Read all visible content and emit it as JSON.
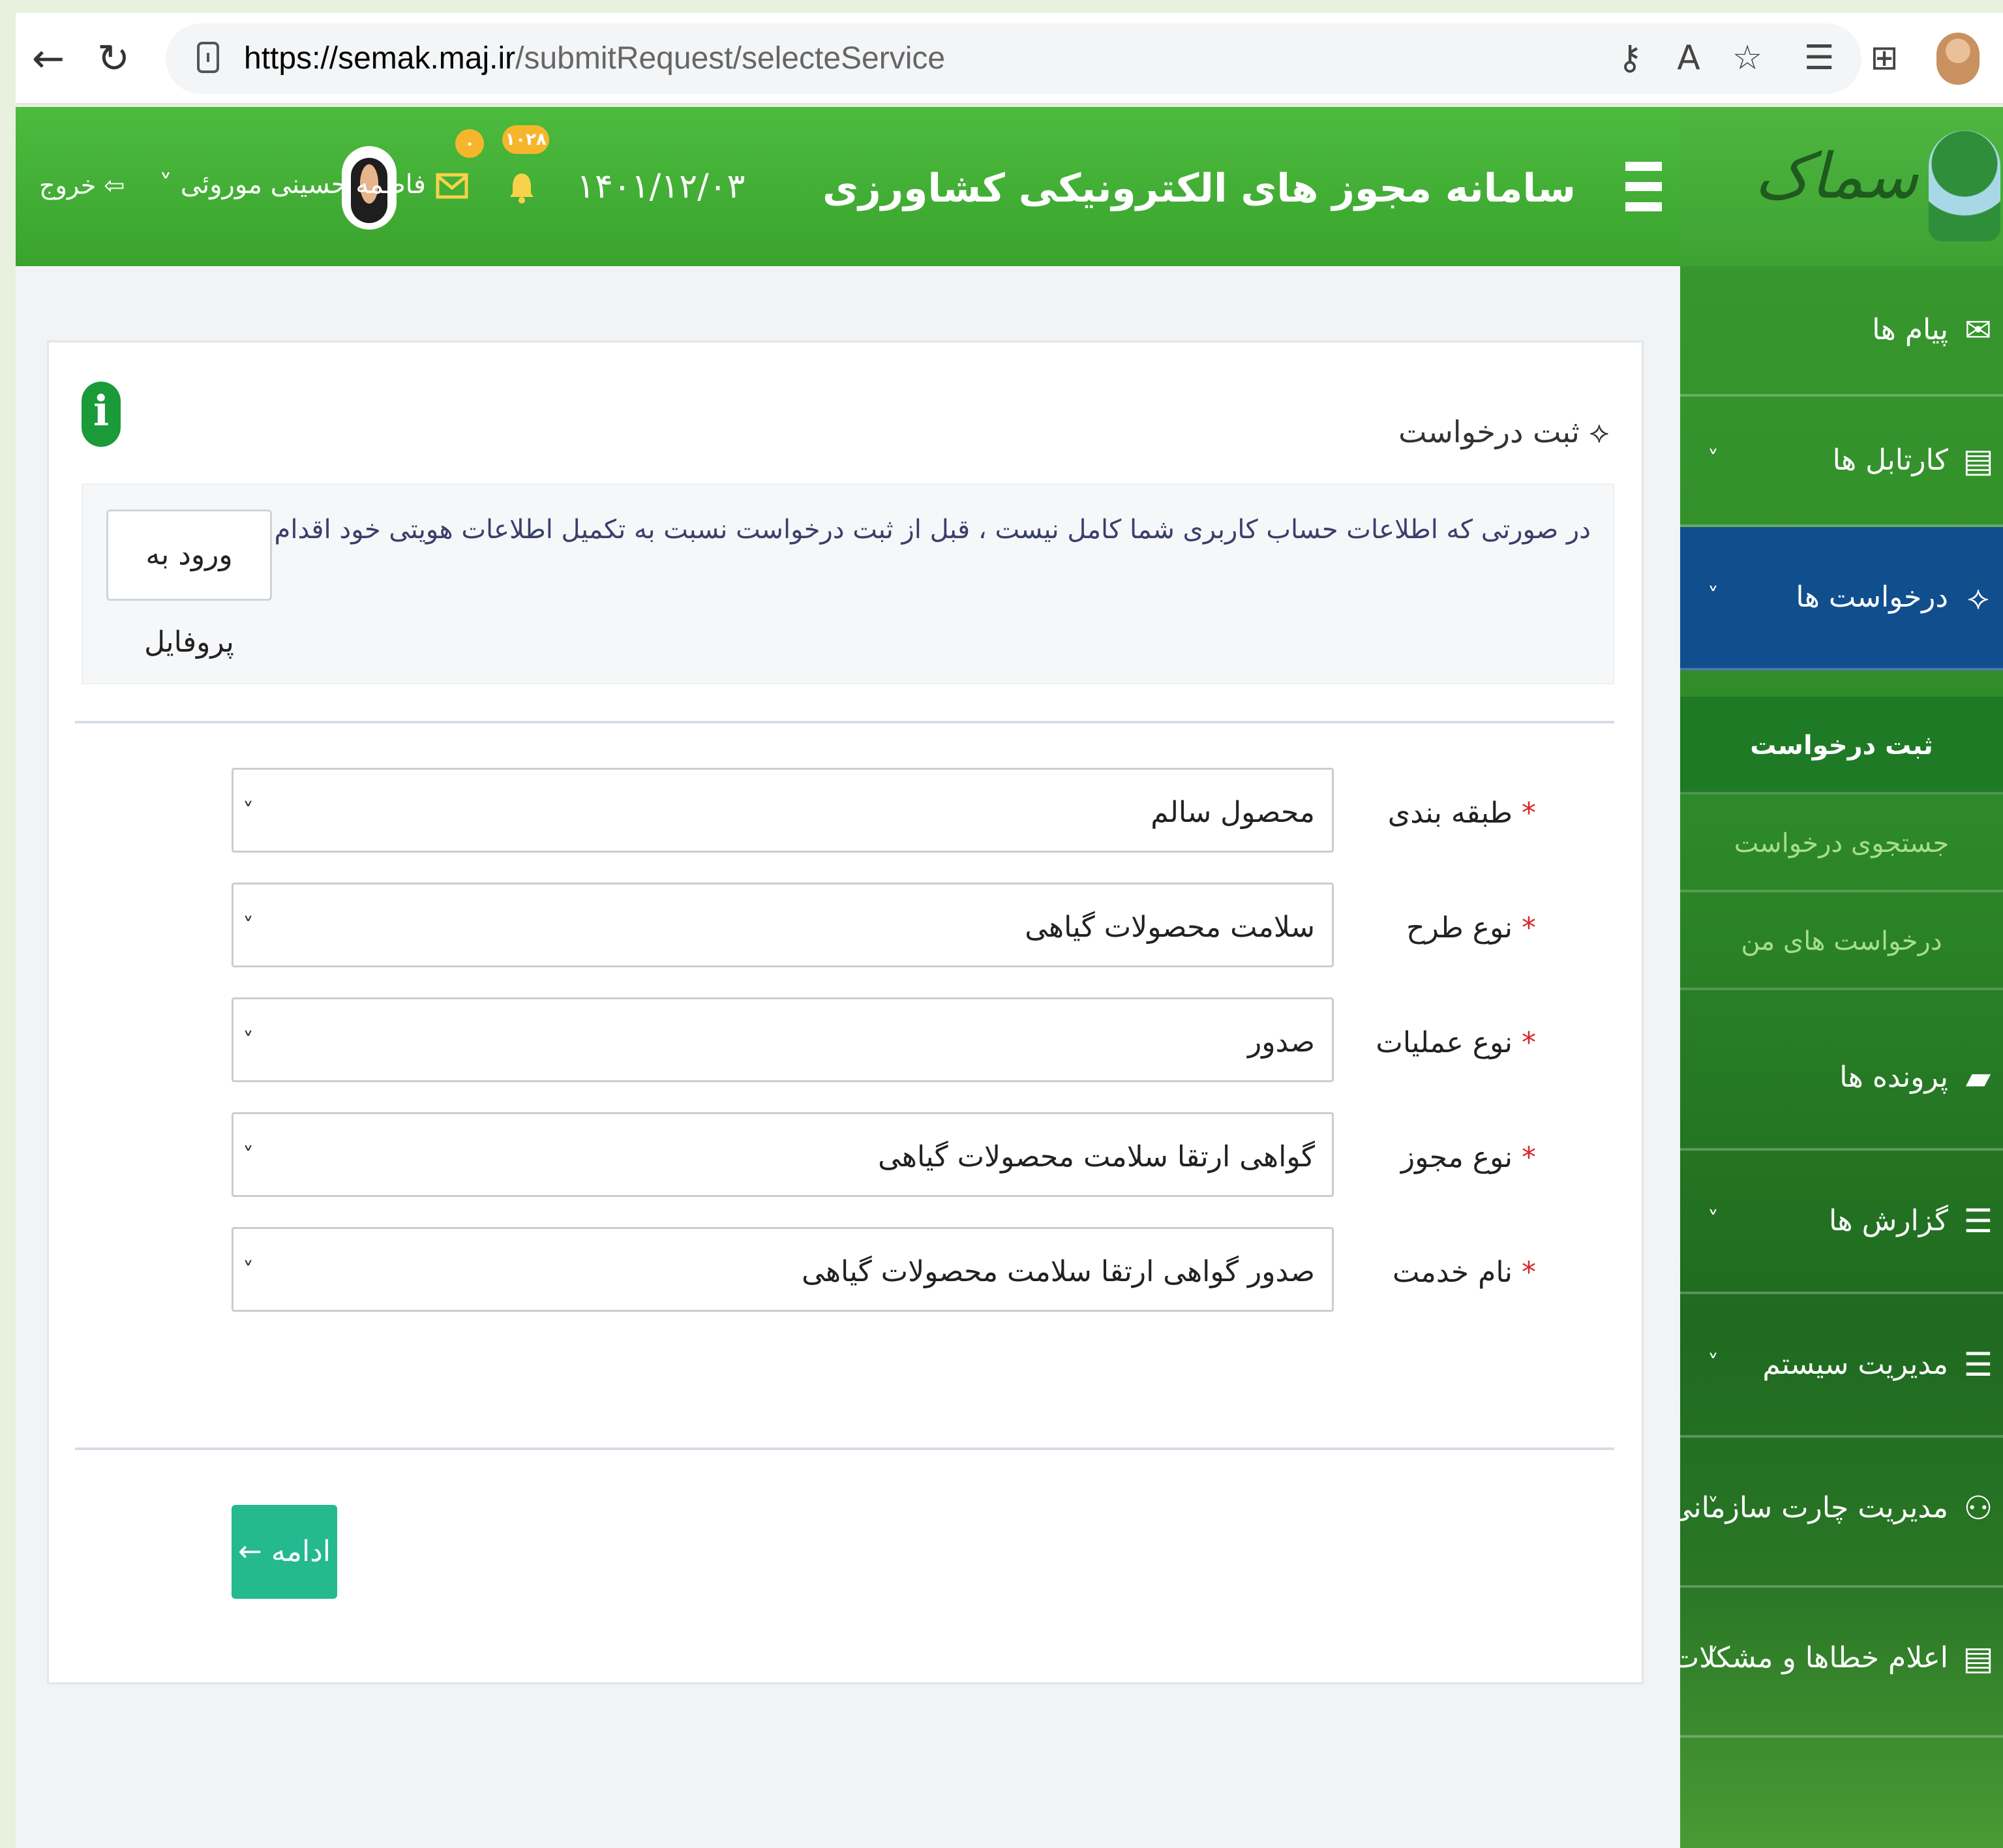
{
  "browser": {
    "url_host": "https://semak.maj.ir",
    "url_path": "/submitRequest/selecteService"
  },
  "header": {
    "title": "سامانه مجوز های الکترونیکی کشاورزی",
    "date": "۱۴۰۱/۱۲/۰۳",
    "notification_count": "۱۰۲۸",
    "message_count": "۰",
    "user_name": "فاطمه حسینی موروئی",
    "logout_label": "خروج"
  },
  "sidebar": {
    "logo_text": "سماک",
    "items": [
      {
        "label": "پیام ها",
        "icon": "envelope-icon",
        "has_chevron": false
      },
      {
        "label": "کارتابل ها",
        "icon": "document-icon",
        "has_chevron": true
      },
      {
        "label": "درخواست ها",
        "icon": "handshake-icon",
        "has_chevron": true,
        "active": true
      },
      {
        "label": "پرونده ها",
        "icon": "folder-icon",
        "has_chevron": false
      },
      {
        "label": "گزارش ها",
        "icon": "list-icon",
        "has_chevron": true
      },
      {
        "label": "مدیریت سیستم",
        "icon": "list-icon",
        "has_chevron": true
      },
      {
        "label": "مدیریت چارت سازمانی",
        "icon": "sitemap-icon",
        "has_chevron": true
      },
      {
        "label": "اعلام خطاها و مشکلات",
        "icon": "document-icon",
        "has_chevron": true
      }
    ],
    "sub_items": [
      {
        "label": "ثبت درخواست",
        "current": true
      },
      {
        "label": "جستجوی درخواست",
        "current": false
      },
      {
        "label": "درخواست های من",
        "current": false
      }
    ]
  },
  "main": {
    "title": "ثبت درخواست",
    "alert_text": "در صورتی که اطلاعات حساب کاربری شما کامل نیست ، قبل از ثبت درخواست نسبت به تکمیل اطلاعات هویتی خود اقدام فرمایید.",
    "profile_button": "ورود به پروفایل",
    "fields": [
      {
        "label": "طبقه بندی",
        "value": "محصول سالم"
      },
      {
        "label": "نوع طرح",
        "value": "سلامت محصولات گیاهی"
      },
      {
        "label": "نوع عملیات",
        "value": "صدور"
      },
      {
        "label": "نوع مجوز",
        "value": "گواهی ارتقا سلامت محصولات گیاهی"
      },
      {
        "label": "نام خدمت",
        "value": "صدور گواهی ارتقا سلامت محصولات گیاهی"
      }
    ],
    "required_mark": "*",
    "continue_button": "ادامه"
  },
  "colors": {
    "header_green": "#3fae33",
    "sidebar_active": "#114e8d",
    "continue_button": "#24b98f",
    "info_icon": "#1b9a3a"
  }
}
